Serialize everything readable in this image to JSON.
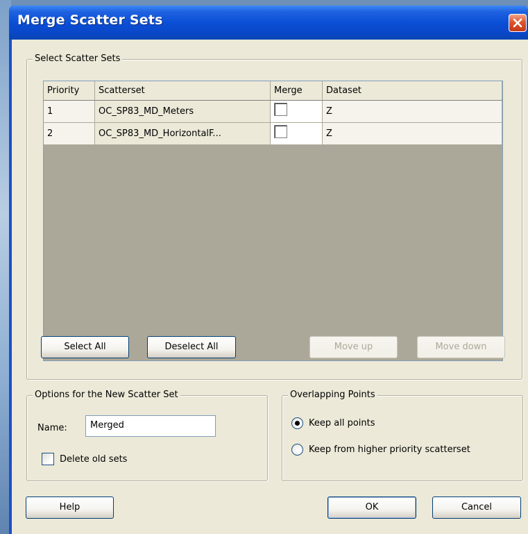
{
  "window": {
    "title": "Merge Scatter Sets",
    "close_icon": "close-icon"
  },
  "select_group": {
    "title": "Select Scatter Sets",
    "columns": [
      "Priority",
      "Scatterset",
      "Merge",
      "Dataset"
    ],
    "rows": [
      {
        "priority": "1",
        "scatterset": "OC_SP83_MD_Meters",
        "merge": false,
        "dataset": "Z"
      },
      {
        "priority": "2",
        "scatterset": "OC_SP83_MD_HorizontalF...",
        "merge": false,
        "dataset": "Z"
      }
    ],
    "buttons": {
      "select_all": "Select All",
      "deselect_all": "Deselect All",
      "move_up": "Move up",
      "move_down": "Move down"
    }
  },
  "options_group": {
    "title": "Options for the New Scatter Set",
    "name_label": "Name:",
    "name_value": "Merged",
    "delete_old_label": "Delete old sets",
    "delete_old_checked": false
  },
  "overlap_group": {
    "title": "Overlapping Points",
    "options": [
      {
        "label": "Keep all points",
        "selected": true
      },
      {
        "label": "Keep from higher priority scatterset",
        "selected": false
      }
    ]
  },
  "footer": {
    "help": "Help",
    "ok": "OK",
    "cancel": "Cancel"
  }
}
